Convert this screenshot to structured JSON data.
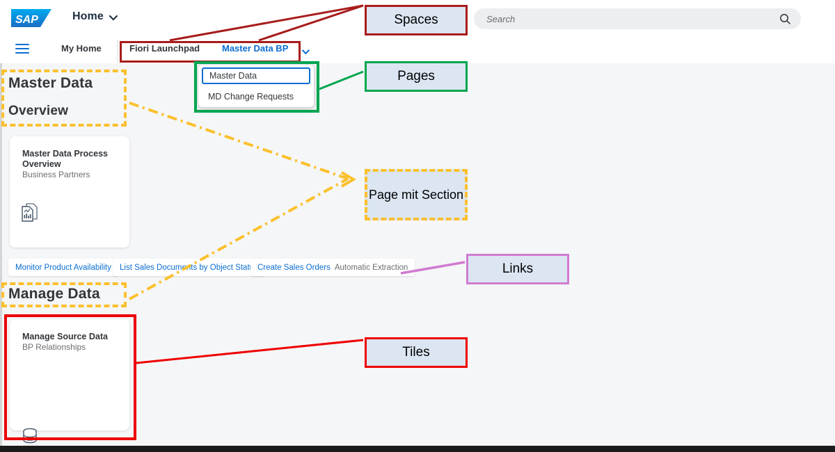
{
  "header": {
    "logo_alt": "SAP",
    "home_menu_label": "Home",
    "search_placeholder": "Search",
    "search_value": ""
  },
  "navbar": {
    "menu_icon": "hamburger-icon",
    "spaces": [
      {
        "label": "My Home",
        "active": false
      },
      {
        "label": "Fiori Launchpad",
        "active": false
      },
      {
        "label": "Master Data BP",
        "active": true
      }
    ],
    "chevron_icon": "chevron-down-icon"
  },
  "page_dropdown": {
    "items": [
      {
        "label": "Master Data",
        "selected": true
      },
      {
        "label": "MD Change Requests",
        "selected": false
      }
    ]
  },
  "content": {
    "sections": [
      {
        "title": "Master Data",
        "subtitle": "Overview"
      },
      {
        "title": "Manage Data"
      }
    ],
    "tiles": [
      {
        "title": "Master Data Process Overview",
        "subtitle": "Business Partners",
        "icon": "report-documents-icon"
      },
      {
        "title": "Manage Source Data",
        "subtitle": "BP Relationships",
        "icon": "database-icon"
      }
    ],
    "links": [
      {
        "primary": "Monitor Product Availability",
        "secondary": ""
      },
      {
        "primary": "List Sales Documents by Object Status",
        "secondary": ""
      },
      {
        "primary": "Create Sales Orders",
        "secondary": "Automatic Extraction"
      }
    ]
  },
  "annotations": {
    "callouts": [
      {
        "label": "Spaces",
        "color": "#a81c1c",
        "style": "solid"
      },
      {
        "label": "Pages",
        "color": "#00a650",
        "style": "solid"
      },
      {
        "label": "Page mit Section",
        "color": "#fbc02d",
        "style": "dashed"
      },
      {
        "label": "Links",
        "color": "#d07bd0",
        "style": "solid"
      },
      {
        "label": "Tiles",
        "color": "#ee0000",
        "style": "solid"
      }
    ],
    "fill_color": "#dce6f2"
  }
}
